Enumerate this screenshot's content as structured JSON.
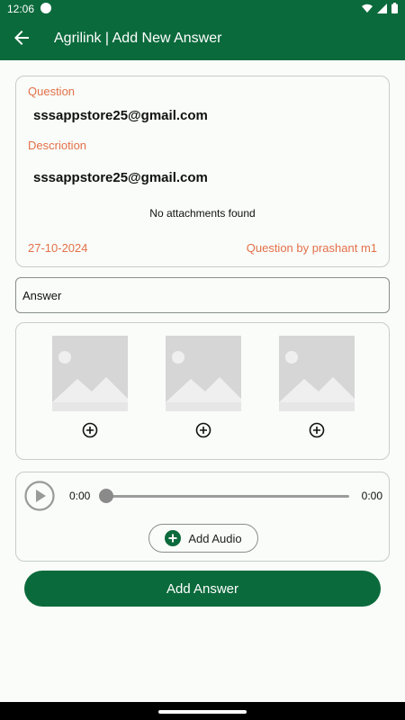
{
  "status_bar": {
    "time": "12:06"
  },
  "app_bar": {
    "title": "Agrilink | Add New Answer"
  },
  "question_card": {
    "question_label": "Question",
    "question_text": "sssappstore25@gmail.com",
    "description_label": "Descriotion",
    "description_text": "sssappstore25@gmail.com",
    "attachments_text": "No attachments found",
    "date": "27-10-2024",
    "author": "Question by prashant m1"
  },
  "answer_field": {
    "placeholder": "Answer",
    "value": ""
  },
  "image_slots": [
    {
      "icon": "image-placeholder-icon",
      "add_icon": "add-circle-icon"
    },
    {
      "icon": "image-placeholder-icon",
      "add_icon": "add-circle-icon"
    },
    {
      "icon": "image-placeholder-icon",
      "add_icon": "add-circle-icon"
    }
  ],
  "audio": {
    "current_time": "0:00",
    "total_time": "0:00",
    "progress": 0,
    "add_label": "Add Audio"
  },
  "submit_label": "Add Answer",
  "colors": {
    "primary": "#0b6a3c",
    "accent": "#e4704a",
    "background": "#f9fcf8"
  }
}
